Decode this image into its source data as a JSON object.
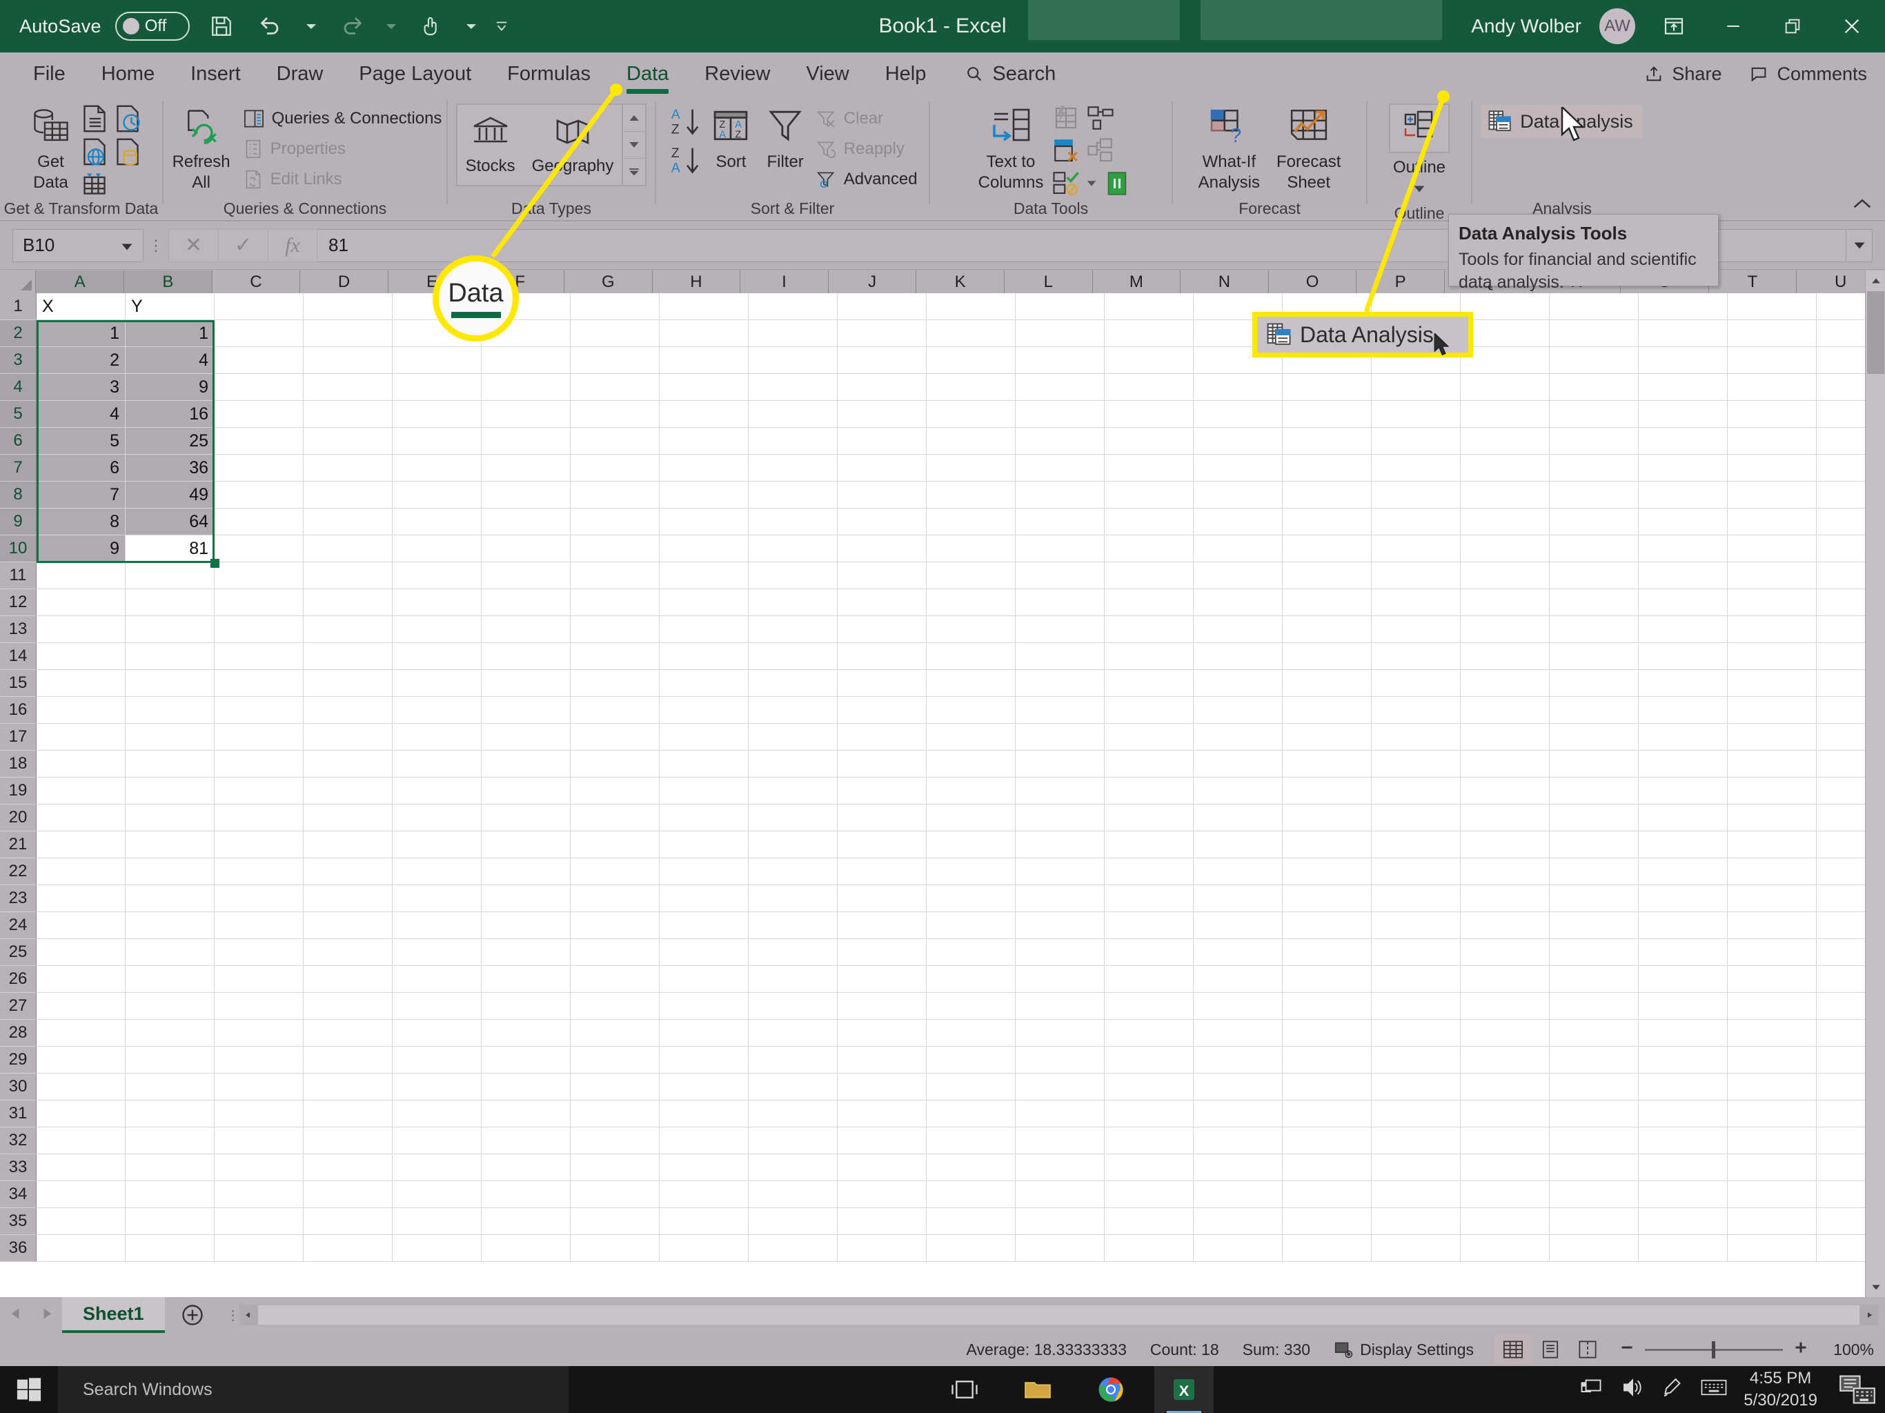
{
  "titlebar": {
    "autosave_label": "AutoSave",
    "autosave_state": "Off",
    "document_title": "Book1  -  Excel",
    "user_name": "Andy Wolber",
    "user_initials": "AW",
    "icons": [
      "save-icon",
      "undo-icon",
      "redo-icon",
      "touch-mode-icon",
      "customize-qat-icon",
      "ribbon-display-options-icon",
      "minimize-icon",
      "restore-icon",
      "close-icon"
    ]
  },
  "tabs": {
    "items": [
      "File",
      "Home",
      "Insert",
      "Draw",
      "Page Layout",
      "Formulas",
      "Data",
      "Review",
      "View",
      "Help"
    ],
    "active": "Data",
    "search_label": "Search",
    "share_label": "Share",
    "comments_label": "Comments"
  },
  "ribbon": {
    "groups": [
      {
        "name": "Get & Transform Data",
        "big": [
          {
            "line1": "Get",
            "line2": "Data",
            "caret": true
          }
        ]
      },
      {
        "name": "Queries & Connections",
        "big": [
          {
            "line1": "Refresh",
            "line2": "All",
            "caret": true
          }
        ],
        "small": [
          {
            "label": "Queries & Connections",
            "disabled": false
          },
          {
            "label": "Properties",
            "disabled": true
          },
          {
            "label": "Edit Links",
            "disabled": true
          }
        ]
      },
      {
        "name": "Data Types",
        "big": [
          {
            "line1": "Stocks",
            "line2": "",
            "caret": false
          },
          {
            "line1": "Geography",
            "line2": "",
            "caret": false
          }
        ]
      },
      {
        "name": "Sort & Filter",
        "big": [
          {
            "line1": "Sort",
            "line2": "",
            "caret": false
          },
          {
            "line1": "Filter",
            "line2": "",
            "caret": false
          }
        ],
        "small": [
          {
            "label": "Clear",
            "disabled": true
          },
          {
            "label": "Reapply",
            "disabled": true
          },
          {
            "label": "Advanced",
            "disabled": false
          }
        ]
      },
      {
        "name": "Data Tools",
        "big": [
          {
            "line1": "Text to",
            "line2": "Columns",
            "caret": false
          }
        ]
      },
      {
        "name": "Forecast",
        "big": [
          {
            "line1": "What-If",
            "line2": "Analysis",
            "caret": true
          },
          {
            "line1": "Forecast",
            "line2": "Sheet",
            "caret": false
          }
        ]
      },
      {
        "name": "Outline",
        "big": [
          {
            "line1": "Outline",
            "line2": "",
            "caret": true
          }
        ]
      },
      {
        "name": "Analysis",
        "analysis_button": "Data Analysis"
      }
    ],
    "collapse_icon": "chevron-up-icon"
  },
  "tooltip": {
    "title": "Data Analysis Tools",
    "body": "Tools for financial and scientific data analysis."
  },
  "formula_bar": {
    "name_box": "B10",
    "cancel_icon": "cancel-icon",
    "enter_icon": "check-icon",
    "function_icon": "fx-icon",
    "value": "81"
  },
  "grid": {
    "columns": [
      "A",
      "B",
      "C",
      "D",
      "E",
      "F",
      "G",
      "H",
      "I",
      "J",
      "K",
      "L",
      "M",
      "N",
      "O",
      "P",
      "Q",
      "R",
      "S",
      "T",
      "U"
    ],
    "selected_columns": [
      "A",
      "B"
    ],
    "rows": [
      "1",
      "2",
      "3",
      "4",
      "5",
      "6",
      "7",
      "8",
      "9",
      "10",
      "11",
      "12",
      "13",
      "14",
      "15",
      "16",
      "17",
      "18",
      "19",
      "20",
      "21",
      "22",
      "23",
      "24",
      "25",
      "26",
      "27",
      "28",
      "29",
      "30",
      "31",
      "32",
      "33",
      "34",
      "35",
      "36"
    ],
    "selected_rows": [
      "2",
      "3",
      "4",
      "5",
      "6",
      "7",
      "8",
      "9",
      "10"
    ],
    "cells": [
      {
        "row": "1",
        "A": "X",
        "B": "Y"
      },
      {
        "row": "2",
        "A": "1",
        "B": "1"
      },
      {
        "row": "3",
        "A": "2",
        "B": "4"
      },
      {
        "row": "4",
        "A": "3",
        "B": "9"
      },
      {
        "row": "5",
        "A": "4",
        "B": "16"
      },
      {
        "row": "6",
        "A": "5",
        "B": "25"
      },
      {
        "row": "7",
        "A": "6",
        "B": "36"
      },
      {
        "row": "8",
        "A": "7",
        "B": "49"
      },
      {
        "row": "9",
        "A": "8",
        "B": "64"
      },
      {
        "row": "10",
        "A": "9",
        "B": "81"
      }
    ],
    "selection_range": "A2:B10",
    "active_cell": "B10"
  },
  "sheet_tabs": {
    "tabs": [
      "Sheet1"
    ],
    "active": "Sheet1",
    "add_label": "+"
  },
  "status_bar": {
    "average": "Average: 18.33333333",
    "count": "Count: 18",
    "sum": "Sum: 330",
    "display_settings": "Display Settings",
    "views": [
      "normal-view-icon",
      "page-layout-view-icon",
      "page-break-view-icon"
    ],
    "active_view": "normal-view-icon",
    "zoom": "100%"
  },
  "callouts": {
    "circle_label": "Data",
    "box_label": "Data Analysis"
  },
  "taskbar": {
    "search_placeholder": "Search Windows",
    "apps": [
      "task-view-icon",
      "file-explorer-icon",
      "chrome-icon",
      "excel-icon"
    ],
    "tray": [
      "network-icon",
      "volume-icon",
      "pen-icon",
      "keyboard-icon"
    ],
    "time": "4:55 PM",
    "date": "5/30/2019"
  },
  "colors": {
    "excel_green": "#15593a",
    "accent_green": "#0d6b3f",
    "callout_yellow": "#ffe800",
    "chrome_gray": "#b8b2b8"
  }
}
